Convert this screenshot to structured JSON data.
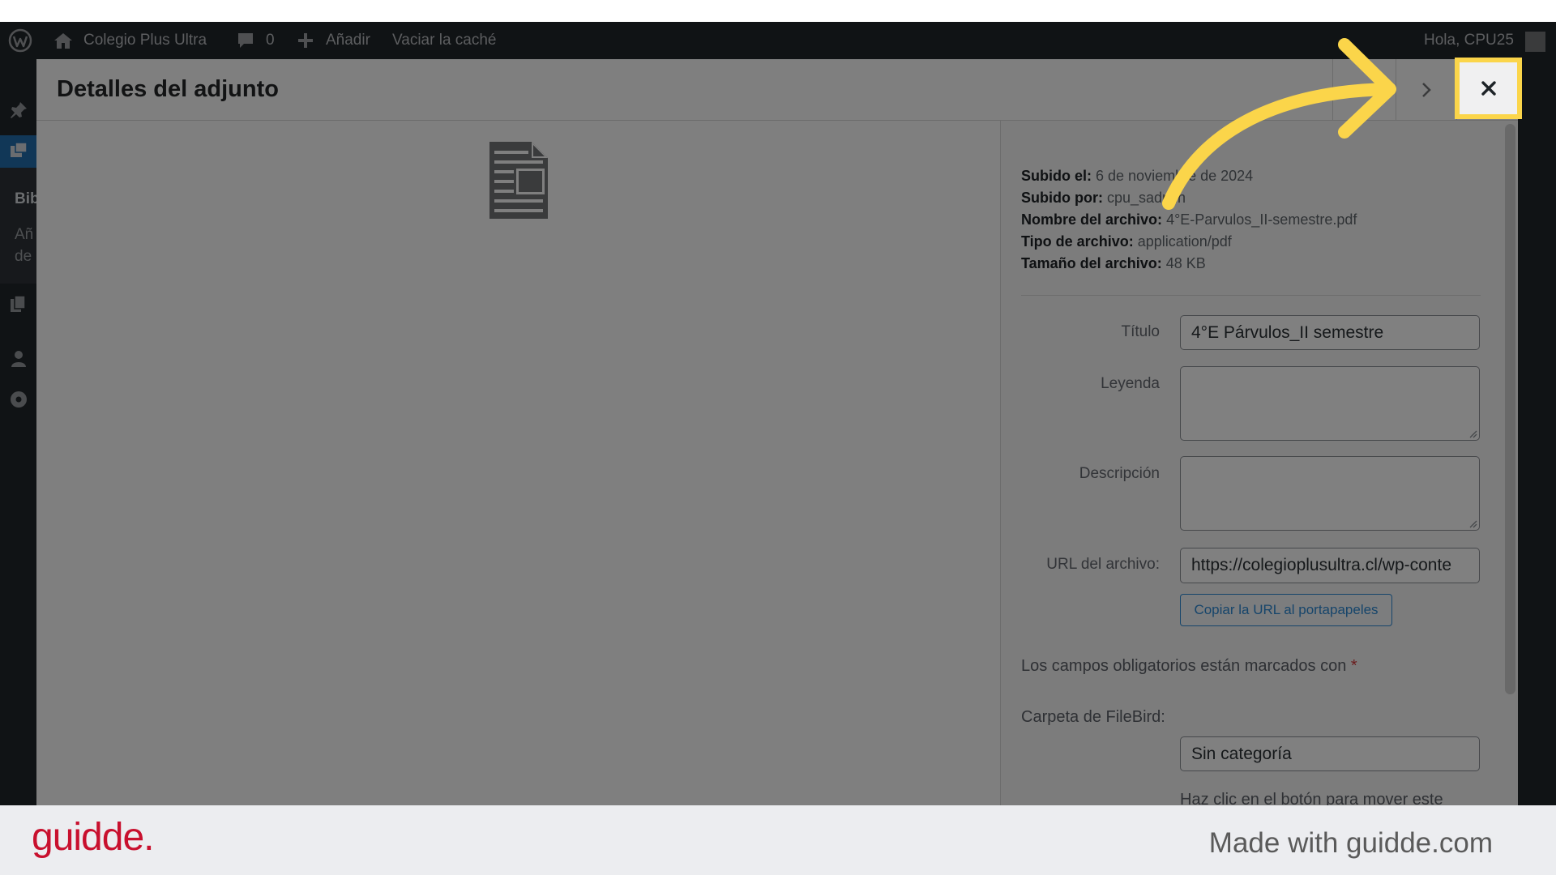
{
  "admin_bar": {
    "site_name": "Colegio Plus Ultra",
    "comments_count": "0",
    "add_new": "Añadir",
    "clear_cache": "Vaciar la caché",
    "greeting": "Hola, CPU25",
    "icons": [
      "wordpress-logo-icon",
      "home-icon",
      "comment-icon",
      "plus-icon",
      "avatar"
    ]
  },
  "admin_menu": {
    "icons": [
      "pin-icon",
      "media-icon",
      "pages-icon",
      "users-icon",
      "settings-circle-icon"
    ],
    "submenu_items": [
      "Bib",
      "Añ",
      "de"
    ]
  },
  "modal": {
    "title": "Detalles del adjunto",
    "icons": {
      "next": "chevron-right-icon",
      "close": "close-icon",
      "preview": "document-icon"
    }
  },
  "details": [
    {
      "label": "Subido el:",
      "value": "6 de noviembre de 2024"
    },
    {
      "label": "Subido por:",
      "value": "cpu_sadmin"
    },
    {
      "label": "Nombre del archivo:",
      "value": "4°E-Parvulos_II-semestre.pdf"
    },
    {
      "label": "Tipo de archivo:",
      "value": "application/pdf"
    },
    {
      "label": "Tamaño del archivo:",
      "value": "48 KB"
    }
  ],
  "form": {
    "title": {
      "label": "Título",
      "value": "4°E Párvulos_II semestre"
    },
    "caption": {
      "label": "Leyenda"
    },
    "description": {
      "label": "Descripción"
    },
    "file_url": {
      "label": "URL del archivo:",
      "value": "https://colegioplusultra.cl/wp-conte"
    },
    "copy_url_button": "Copiar la URL al portapapeles",
    "required_note": "Los campos obligatorios están marcados con",
    "required_mark": "*",
    "filebird_folder": {
      "label": "Carpeta de FileBird:",
      "value": "Sin categoría",
      "hint": "Haz clic en el botón para mover este"
    }
  },
  "footer": {
    "logo": "guidde.",
    "credit": "Made with guidde.com"
  },
  "colors": {
    "highlight": "#fbd54a",
    "brand_red": "#c8102e",
    "link_blue": "#2271b1",
    "required_red": "#d63638"
  }
}
